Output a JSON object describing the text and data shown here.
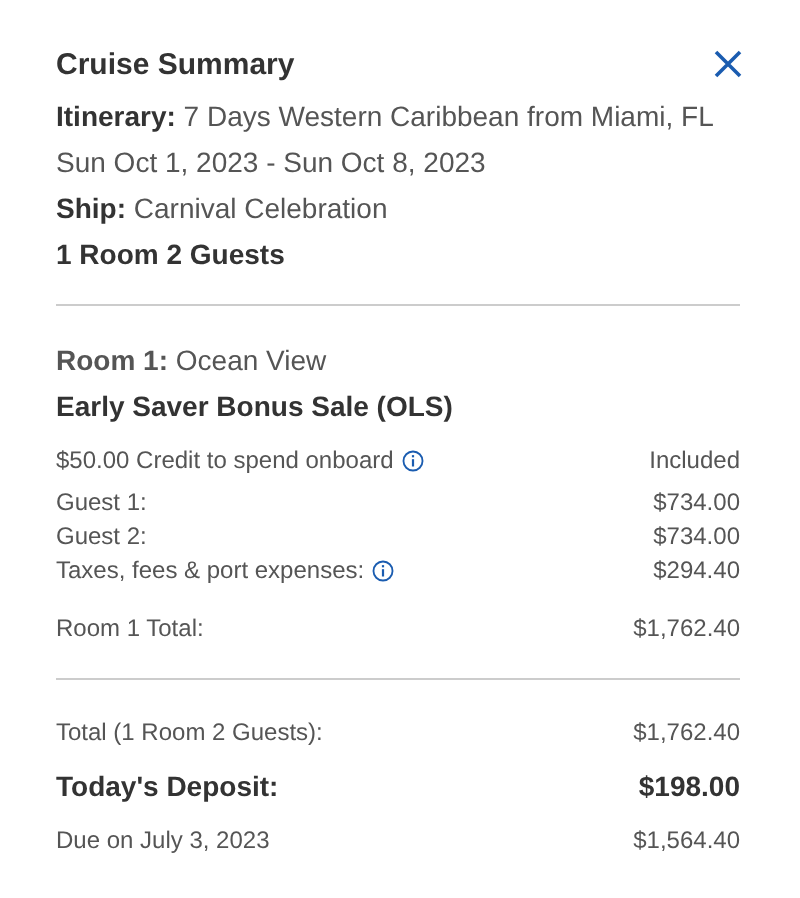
{
  "title": "Cruise Summary",
  "details": [
    "**Itinerary:** 7 Days Western Caribbean from Miami, FL",
    "Sun Oct 1, 2023 - Sun Oct 8, 2023",
    "**Ship:** Carnival Celebration"
  ],
  "guests_summary": "1 Room 2 Guests",
  "room": {
    "heading": "**Room 1:** Ocean View",
    "promotion": "Early Saver Bonus Sale (OLS)",
    "items": [
      {
        "label": "$50.00 Credit to spend onboard",
        "value": "Included",
        "info": true
      },
      {
        "label": "Guest 1:",
        "value": "$734.00",
        "info": false
      },
      {
        "label": "Guest 2:",
        "value": "$734.00",
        "info": false
      },
      {
        "label": "Taxes, fees & port expenses:",
        "value": "$294.40",
        "info": true
      }
    ],
    "total": {
      "label": "Room 1 Total:",
      "value": "$1,762.40"
    }
  },
  "totals": [
    {
      "label": "Total (1 Room 2 Guests):",
      "value": "$1,762.40",
      "kind": "normal"
    },
    {
      "label": "Today's Deposit:",
      "value": "$198.00",
      "kind": "emphasis"
    },
    {
      "label": "Due on July 3, 2023",
      "value": "$1,564.40",
      "kind": "normal"
    }
  ]
}
